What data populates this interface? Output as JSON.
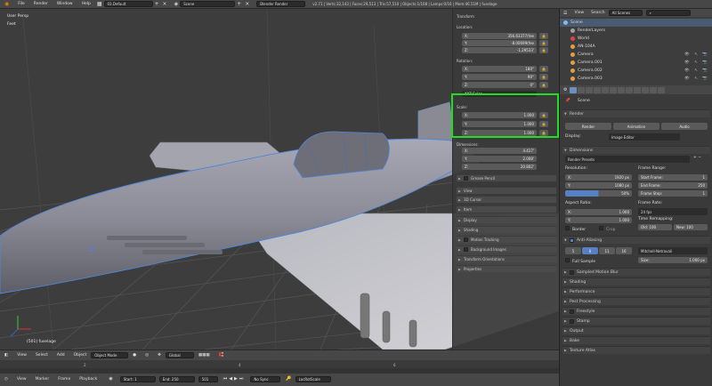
{
  "topbar": {
    "menus": [
      "File",
      "Render",
      "Window",
      "Help"
    ],
    "screen": "03.Default",
    "scene": "Scene",
    "engine": "Blender Render",
    "stats": "v2.71 | Verts:32,143 | Faces:29,513 | Tris:57,510 | Objects:1/108 | Lamps:0/16 | Mem:46.51M | fuselage"
  },
  "viewport": {
    "view_label": "User Persp",
    "units_label": "Feet",
    "object_label": "(501) fuselage"
  },
  "npanel": {
    "transform_header": "Transform",
    "location_label": "Location:",
    "location": [
      {
        "axis": "X:",
        "value": "356.63377(fee"
      },
      {
        "axis": "Y:",
        "value": "-8.00699(fee"
      },
      {
        "axis": "Z:",
        "value": "-1.29533'"
      }
    ],
    "rotation_label": "Rotation:",
    "rotation": [
      {
        "axis": "X:",
        "value": "180°"
      },
      {
        "axis": "Y:",
        "value": "90°"
      },
      {
        "axis": "Z:",
        "value": "0°"
      }
    ],
    "rotation_mode": "XYZ Euler",
    "scale_label": "Scale:",
    "scale": [
      {
        "axis": "X:",
        "value": "1.000"
      },
      {
        "axis": "Y:",
        "value": "1.000"
      },
      {
        "axis": "Z:",
        "value": "1.000"
      }
    ],
    "dimensions_label": "Dimensions:",
    "dimensions": [
      {
        "axis": "X:",
        "value": "4.417'"
      },
      {
        "axis": "Y:",
        "value": "2.008'"
      },
      {
        "axis": "Z:",
        "value": "20.802'"
      }
    ],
    "lock_glyph": "🔒",
    "panels": [
      "Grease Pencil",
      "View",
      "3D Cursor",
      "Item",
      "Display",
      "Shading",
      "Motion Tracking",
      "Background Images",
      "Transform Orientations",
      "Properties"
    ]
  },
  "timeline": {
    "menus": [
      "View",
      "Marker",
      "Frame",
      "Playback"
    ],
    "start_label": "Start:",
    "start_value": "1",
    "end_label": "End:",
    "end_value": "250",
    "current_frame": "501",
    "sync": "No Sync",
    "keying": "LocRotScale",
    "ruler_ticks": [
      "2",
      "4",
      "6"
    ]
  },
  "viewport_header": {
    "menus": [
      "View",
      "Select",
      "Add",
      "Object"
    ],
    "mode": "Object Mode",
    "orientation": "Global"
  },
  "outliner": {
    "menus": [
      "View",
      "Search"
    ],
    "filter": "All Scenes",
    "items": [
      {
        "label": "Scene",
        "color": "#8cb4e8"
      },
      {
        "label": "RenderLayers",
        "color": "#a0a0a0"
      },
      {
        "label": "World",
        "color": "#d44"
      },
      {
        "label": "AN-104A",
        "color": "#e0a040"
      },
      {
        "label": "Camera",
        "color": "#e0a040"
      },
      {
        "label": "Camera.001",
        "color": "#e0a040"
      },
      {
        "label": "Camera.002",
        "color": "#e0a040"
      },
      {
        "label": "Camera.003",
        "color": "#e0a040"
      }
    ]
  },
  "properties": {
    "scene_label": "Scene",
    "render_panel": "Render",
    "render_buttons": [
      "Render",
      "Animation",
      "Audio"
    ],
    "display_label": "Display:",
    "display_value": "Image Editor",
    "dimensions_panel": "Dimensions",
    "render_presets": "Render Presets",
    "resolution_label": "Resolution:",
    "res_x": {
      "label": "X:",
      "value": "1920 px"
    },
    "res_y": {
      "label": "Y:",
      "value": "1080 px"
    },
    "res_pct": "50%",
    "frame_range_label": "Frame Range:",
    "start_frame": {
      "label": "Start Frame:",
      "value": "1"
    },
    "end_frame": {
      "label": "End Frame:",
      "value": "250"
    },
    "frame_step": {
      "label": "Frame Step:",
      "value": "1"
    },
    "aspect_label": "Aspect Ratio:",
    "aspect_x": {
      "label": "X:",
      "value": "1.000"
    },
    "aspect_y": {
      "label": "Y:",
      "value": "1.000"
    },
    "frame_rate_label": "Frame Rate:",
    "frame_rate": "24 fps",
    "time_remap_label": "Time Remapping:",
    "old": "Old: 100",
    "new": "New: 100",
    "border_label": "Border",
    "crop_label": "Crop",
    "aa_panel": "Anti-Aliasing",
    "aa_samples": [
      "5",
      "8",
      "11",
      "16"
    ],
    "aa_filter": "Mitchell-Netravali",
    "full_sample": "Full Sample",
    "aa_size": {
      "label": "Size:",
      "value": "1.000 px"
    },
    "panels": [
      "Sampled Motion Blur",
      "Shading",
      "Performance",
      "Post Processing",
      "Freestyle",
      "Stamp",
      "Output",
      "Bake",
      "Texture Atlas"
    ]
  },
  "colors": {
    "highlight": "#22dd22",
    "accent": "#5680c2"
  }
}
